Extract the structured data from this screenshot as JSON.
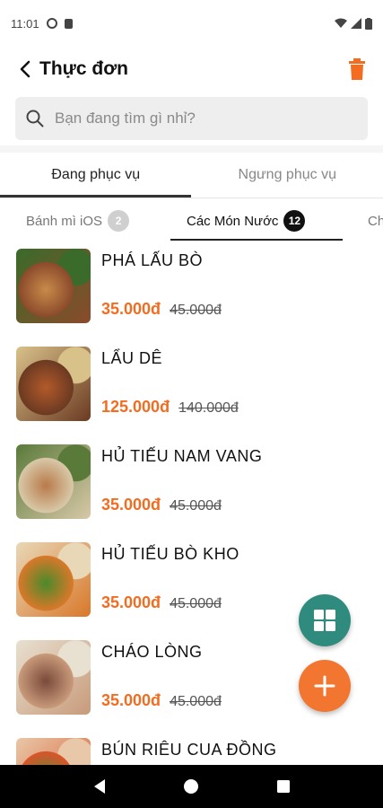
{
  "status_bar": {
    "time": "11:01"
  },
  "header": {
    "title": "Thực đơn"
  },
  "search": {
    "placeholder": "Bạn đang tìm gì nhỉ?"
  },
  "main_tabs": [
    {
      "label": "Đang phục vụ",
      "active": true
    },
    {
      "label": "Ngưng phục vụ",
      "active": false
    }
  ],
  "category_tabs": [
    {
      "label": "Bánh mì iOS",
      "count": "2",
      "active": false
    },
    {
      "label": "Các Món Nước",
      "count": "12",
      "active": true
    },
    {
      "label": "Ch",
      "count": "",
      "active": false
    }
  ],
  "items": [
    {
      "name": "PHÁ LẤU BÒ",
      "price": "35.000đ",
      "old_price": "45.000đ",
      "thumb_colors": [
        "#8b4a2b",
        "#c98b4a",
        "#3a6b2a"
      ]
    },
    {
      "name": "LẨU DÊ",
      "price": "125.000đ",
      "old_price": "140.000đ",
      "thumb_colors": [
        "#6b3a22",
        "#b35a2a",
        "#d9c28a"
      ]
    },
    {
      "name": "HỦ TIẾU NAM VANG",
      "price": "35.000đ",
      "old_price": "45.000đ",
      "thumb_colors": [
        "#d8c8a8",
        "#b87a4a",
        "#5a7a3a"
      ]
    },
    {
      "name": "HỦ TIẾU BÒ KHO",
      "price": "35.000đ",
      "old_price": "45.000đ",
      "thumb_colors": [
        "#d9782a",
        "#4a8a2a",
        "#e8d8b8"
      ]
    },
    {
      "name": "CHÁO LÒNG",
      "price": "35.000đ",
      "old_price": "45.000đ",
      "thumb_colors": [
        "#c89a7a",
        "#7a4a3a",
        "#e8e0d0"
      ]
    },
    {
      "name": "BÚN RIÊU CUA ĐỒNG",
      "price": "",
      "old_price": "",
      "thumb_colors": [
        "#d9542a",
        "#5a8a3a",
        "#e8c8a8"
      ]
    }
  ],
  "colors": {
    "accent": "#f26d21",
    "fab_grid": "#2e8b7d",
    "fab_add": "#f2762f"
  }
}
